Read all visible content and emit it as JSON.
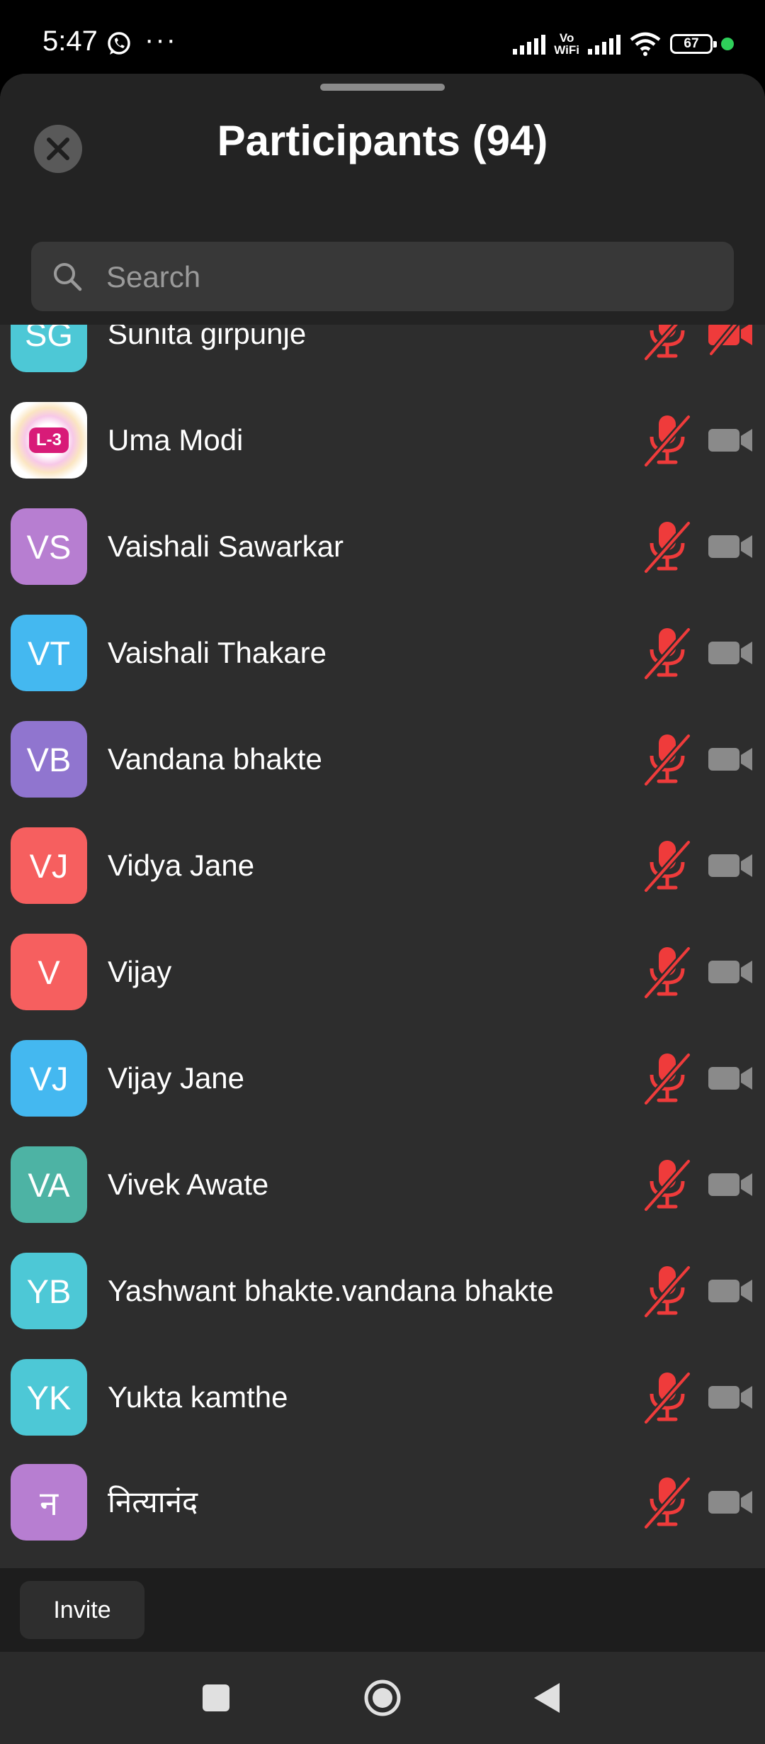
{
  "status_bar": {
    "time": "5:47",
    "notification_icons": [
      "whatsapp-icon",
      "more-dots-icon"
    ],
    "more_dots": "···",
    "vo_label": "Vo",
    "wifi_label": "WiFi",
    "battery": "67",
    "colors": {
      "charging_dot": "#2fcf5a"
    }
  },
  "sheet": {
    "title": "Participants (94)",
    "close_icon": "close-icon",
    "search": {
      "placeholder": "Search"
    }
  },
  "participants": [
    {
      "initials": "SG",
      "name": "Sunita girpunje",
      "avatar_color": "#4dc8d6",
      "mic": "muted",
      "video": "off"
    },
    {
      "initials": "L-3",
      "name": "Uma Modi",
      "avatar_color": "#ffffff",
      "avatar_type": "image",
      "mic": "muted",
      "video": "on"
    },
    {
      "initials": "VS",
      "name": "Vaishali Sawarkar",
      "avatar_color": "#b77ed1",
      "mic": "muted",
      "video": "on"
    },
    {
      "initials": "VT",
      "name": "Vaishali Thakare",
      "avatar_color": "#44b8f0",
      "mic": "muted",
      "video": "on"
    },
    {
      "initials": "VB",
      "name": "Vandana bhakte",
      "avatar_color": "#9075cf",
      "mic": "muted",
      "video": "on"
    },
    {
      "initials": "VJ",
      "name": "Vidya Jane",
      "avatar_color": "#f65f5f",
      "mic": "muted",
      "video": "on"
    },
    {
      "initials": "V",
      "name": "Vijay",
      "avatar_color": "#f65f5f",
      "mic": "muted",
      "video": "on"
    },
    {
      "initials": "VJ",
      "name": "Vijay Jane",
      "avatar_color": "#44b8f0",
      "mic": "muted",
      "video": "on"
    },
    {
      "initials": "VA",
      "name": "Vivek Awate",
      "avatar_color": "#4db3a4",
      "mic": "muted",
      "video": "on"
    },
    {
      "initials": "YB",
      "name": "Yashwant bhakte.vandana bhakte",
      "avatar_color": "#4dc8d6",
      "mic": "muted",
      "video": "on"
    },
    {
      "initials": "YK",
      "name": "Yukta kamthe",
      "avatar_color": "#4dc8d6",
      "mic": "muted",
      "video": "on"
    },
    {
      "initials": "न",
      "name": "नित्यानंद",
      "avatar_color": "#b77ed1",
      "mic": "muted",
      "video": "on"
    }
  ],
  "footer": {
    "invite_label": "Invite"
  },
  "navbar": {
    "icons": [
      "recents-icon",
      "home-icon",
      "back-icon"
    ]
  },
  "colors": {
    "muted_red": "#ef3b3b",
    "cam_gray": "#8a8a8a"
  }
}
